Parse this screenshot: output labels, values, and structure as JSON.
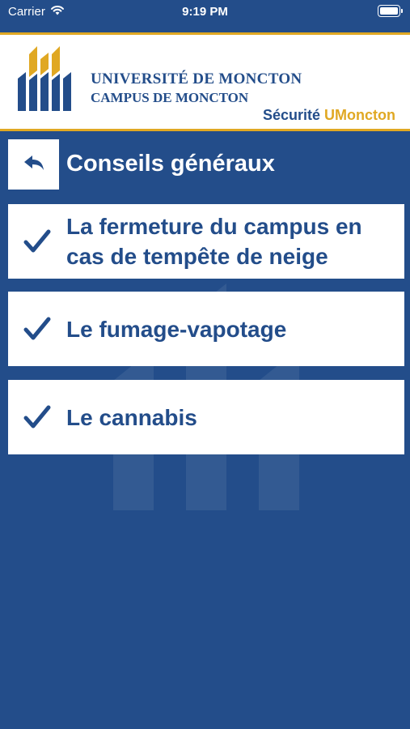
{
  "status_bar": {
    "carrier": "Carrier",
    "time": "9:19 PM"
  },
  "header": {
    "university": "UNIVERSITÉ DE MONCTON",
    "campus": "CAMPUS DE MONCTON",
    "app_name_part1": "Sécurité",
    "app_name_part2": "UMoncton"
  },
  "section": {
    "title": "Conseils généraux",
    "back_icon": "back-arrow-icon"
  },
  "items": [
    {
      "label": "La fermeture du campus en cas de tempête de neige",
      "icon": "checkmark-icon"
    },
    {
      "label": "Le fumage-vapotage",
      "icon": "checkmark-icon"
    },
    {
      "label": "Le cannabis",
      "icon": "checkmark-icon"
    }
  ],
  "colors": {
    "primary_blue": "#234d8a",
    "accent_gold": "#e0a823",
    "white": "#ffffff"
  }
}
